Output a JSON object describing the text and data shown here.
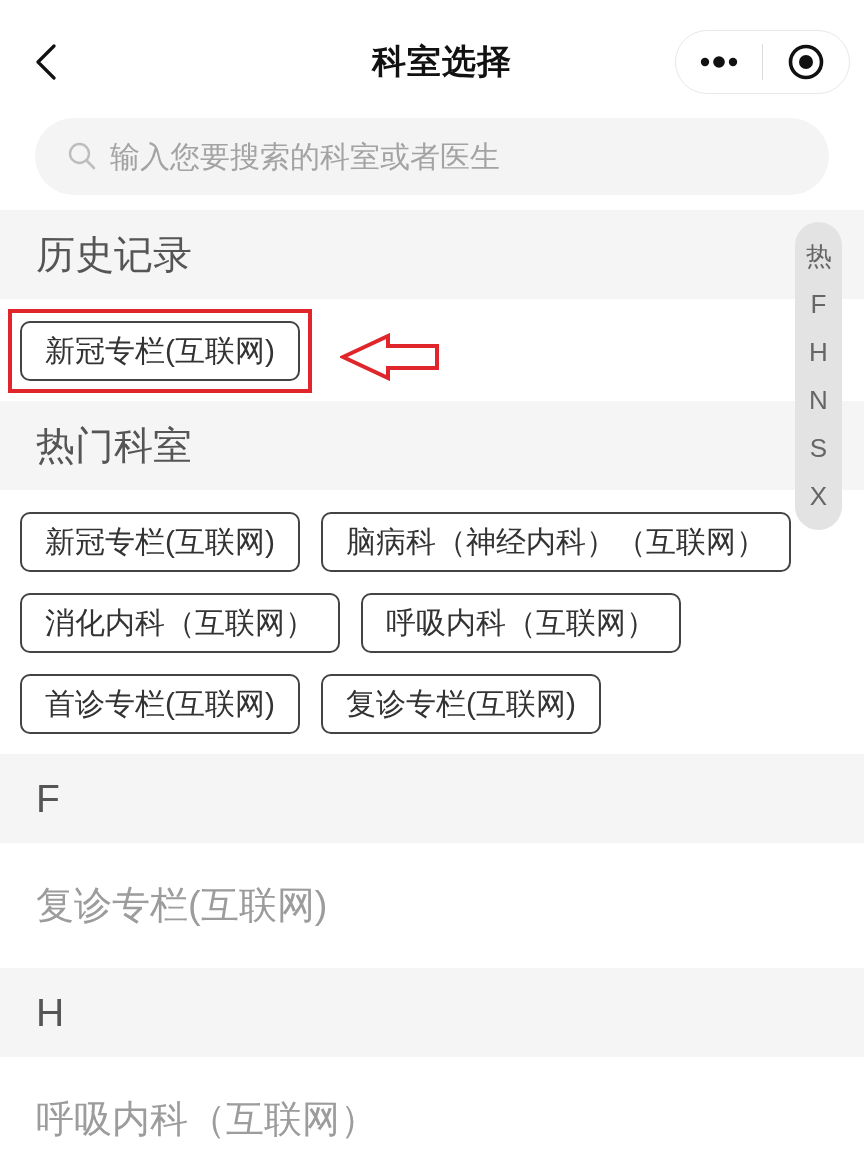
{
  "nav_bar": {
    "title": "科室选择"
  },
  "search": {
    "placeholder": "输入您要搜索的科室或者医生"
  },
  "sections": [
    {
      "kind": "chips",
      "title": "历史记录",
      "items": [
        {
          "label": "新冠专栏(互联网)",
          "annotated": true
        }
      ]
    },
    {
      "kind": "chips",
      "title": "热门科室",
      "items": [
        {
          "label": "新冠专栏(互联网)",
          "annotated": false
        },
        {
          "label": "脑病科（神经内科）（互联网）",
          "annotated": false
        },
        {
          "label": "消化内科（互联网）",
          "annotated": false
        },
        {
          "label": "呼吸内科（互联网）",
          "annotated": false
        },
        {
          "label": "首诊专栏(互联网)",
          "annotated": false
        },
        {
          "label": "复诊专栏(互联网)",
          "annotated": false
        }
      ]
    },
    {
      "kind": "list",
      "title": "F",
      "items": [
        {
          "label": "复诊专栏(互联网)"
        }
      ]
    },
    {
      "kind": "list",
      "title": "H",
      "items": [
        {
          "label": "呼吸内科（互联网）"
        }
      ]
    }
  ],
  "index_bar": {
    "letters": [
      "热",
      "F",
      "H",
      "N",
      "S",
      "X"
    ]
  }
}
